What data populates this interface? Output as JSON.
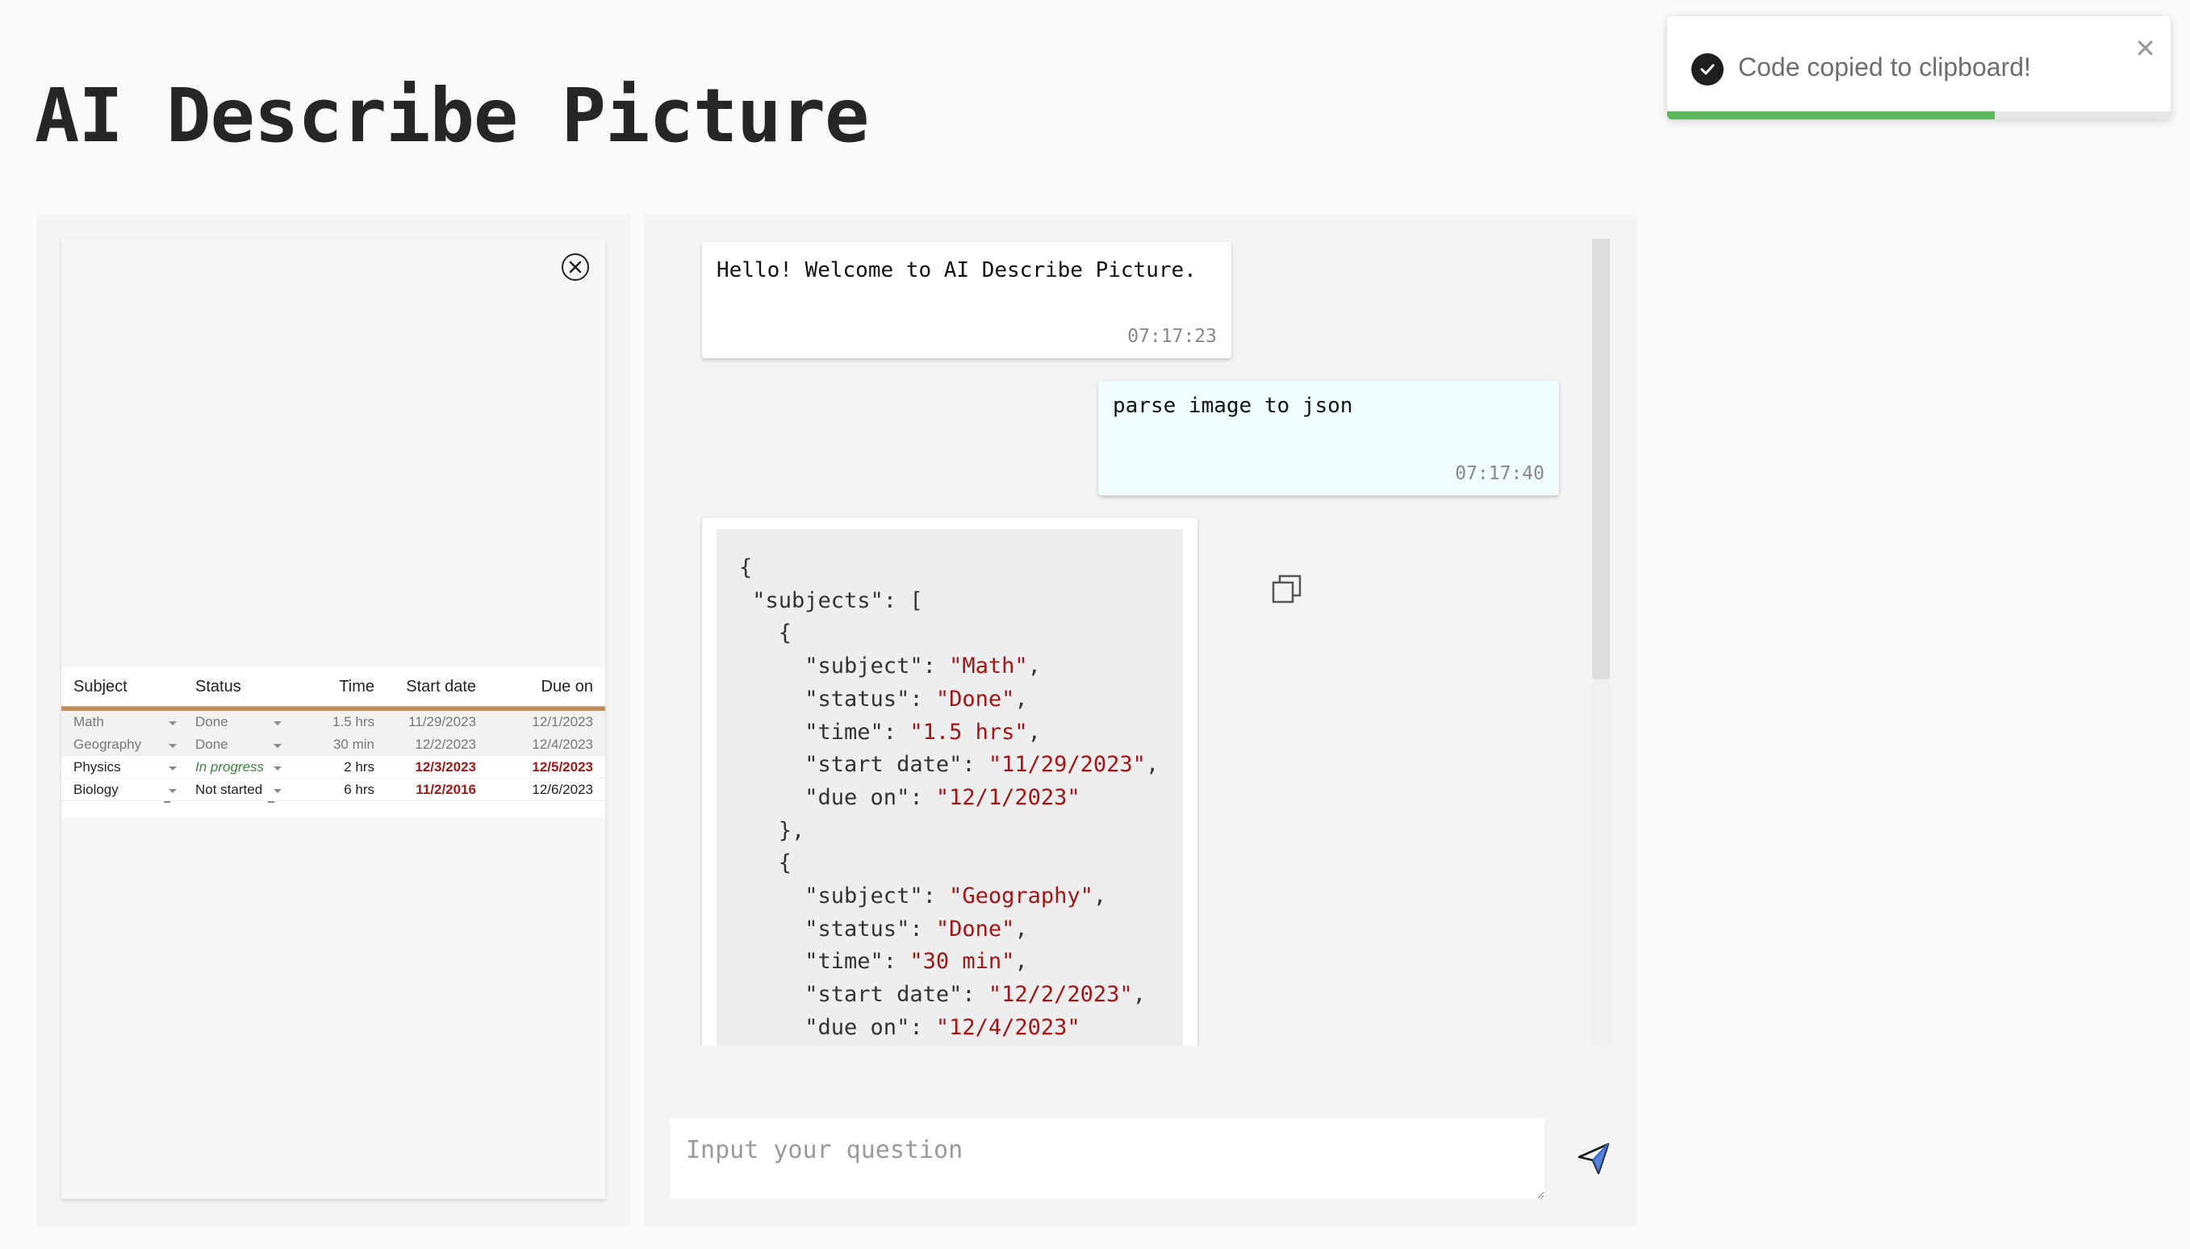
{
  "page": {
    "title": "AI Describe Picture"
  },
  "preview": {
    "close_icon": "close-circle-icon",
    "sheet": {
      "headers": [
        "Subject",
        "Status",
        "Time",
        "Start date",
        "Due on"
      ],
      "rows": [
        {
          "subject": "Math",
          "status": "Done",
          "time": "1.5 hrs",
          "start": "11/29/2023",
          "due": "12/1/2023",
          "state": "done"
        },
        {
          "subject": "Geography",
          "status": "Done",
          "time": "30 min",
          "start": "12/2/2023",
          "due": "12/4/2023",
          "state": "done"
        },
        {
          "subject": "Physics",
          "status": "In progress",
          "time": "2 hrs",
          "start": "12/3/2023",
          "due": "12/5/2023",
          "state": "progress"
        },
        {
          "subject": "Biology",
          "status": "Not started",
          "time": "6 hrs",
          "start": "11/2/2016",
          "due": "12/6/2023",
          "state": "notstarted"
        }
      ]
    }
  },
  "chat": {
    "messages": [
      {
        "role": "assistant",
        "text": "Hello! Welcome to AI Describe Picture.",
        "time": "07:17:23"
      },
      {
        "role": "user",
        "text": "parse image to json",
        "time": "07:17:40"
      }
    ],
    "code_lines": [
      [
        {
          "t": "{",
          "c": "p"
        }
      ],
      [
        {
          "t": " \"subjects\": [",
          "c": "p"
        }
      ],
      [
        {
          "t": "   {",
          "c": "p"
        }
      ],
      [
        {
          "t": "     \"subject\": ",
          "c": "p"
        },
        {
          "t": "\"Math\"",
          "c": "s"
        },
        {
          "t": ",",
          "c": "p"
        }
      ],
      [
        {
          "t": "     \"status\": ",
          "c": "p"
        },
        {
          "t": "\"Done\"",
          "c": "s"
        },
        {
          "t": ",",
          "c": "p"
        }
      ],
      [
        {
          "t": "     \"time\": ",
          "c": "p"
        },
        {
          "t": "\"1.5 hrs\"",
          "c": "s"
        },
        {
          "t": ",",
          "c": "p"
        }
      ],
      [
        {
          "t": "     \"start date\": ",
          "c": "p"
        },
        {
          "t": "\"11/29/2023\"",
          "c": "s"
        },
        {
          "t": ",",
          "c": "p"
        }
      ],
      [
        {
          "t": "     \"due on\": ",
          "c": "p"
        },
        {
          "t": "\"12/1/2023\"",
          "c": "s"
        }
      ],
      [
        {
          "t": "   },",
          "c": "p"
        }
      ],
      [
        {
          "t": "   {",
          "c": "p"
        }
      ],
      [
        {
          "t": "     \"subject\": ",
          "c": "p"
        },
        {
          "t": "\"Geography\"",
          "c": "s"
        },
        {
          "t": ",",
          "c": "p"
        }
      ],
      [
        {
          "t": "     \"status\": ",
          "c": "p"
        },
        {
          "t": "\"Done\"",
          "c": "s"
        },
        {
          "t": ",",
          "c": "p"
        }
      ],
      [
        {
          "t": "     \"time\": ",
          "c": "p"
        },
        {
          "t": "\"30 min\"",
          "c": "s"
        },
        {
          "t": ",",
          "c": "p"
        }
      ],
      [
        {
          "t": "     \"start date\": ",
          "c": "p"
        },
        {
          "t": "\"12/2/2023\"",
          "c": "s"
        },
        {
          "t": ",",
          "c": "p"
        }
      ],
      [
        {
          "t": "     \"due on\": ",
          "c": "p"
        },
        {
          "t": "\"12/4/2023\"",
          "c": "s"
        }
      ]
    ],
    "copy_icon": "copy-icon",
    "input_placeholder": "Input your question",
    "send_icon": "send-icon"
  },
  "toast": {
    "message": "Code copied to clipboard!",
    "icon": "check-circle-icon",
    "close_icon": "close-icon",
    "progress": 0.65
  },
  "colors": {
    "accent": "#5cb85c",
    "string": "#a31515",
    "user_bubble": "#f0fdfd",
    "sheet_rule": "#c58c5b"
  }
}
